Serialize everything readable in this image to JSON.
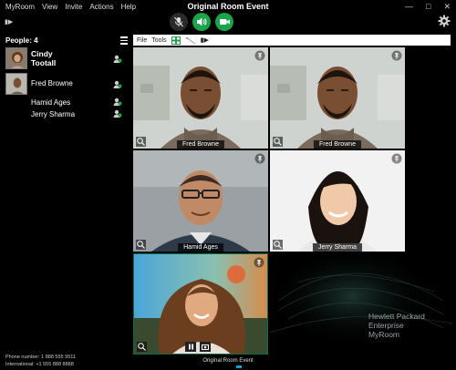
{
  "menu": [
    "MyRoom",
    "View",
    "Invite",
    "Actions",
    "Help"
  ],
  "window": {
    "title": "Original Room Event"
  },
  "sidebar": {
    "people_header": "People: 4",
    "people": [
      {
        "name_line1": "Cindy",
        "name_line2": "Tootall"
      },
      {
        "name": "Fred Browne"
      },
      {
        "name": "Hamid Ages"
      },
      {
        "name": "Jerry Sharma"
      }
    ],
    "footer_phone": "Phone number: 1 888 555 9511",
    "footer_intl": "International: +1 555 888 8888"
  },
  "toolbar": {
    "file": "File",
    "tools": "Tools"
  },
  "tiles": [
    {
      "label": "Fred Browne"
    },
    {
      "label": "Fred Browne"
    },
    {
      "label": "Hamid Ages"
    },
    {
      "label": "Jerry Sharma"
    }
  ],
  "brand": {
    "line1": "Hewlett Packard",
    "line2": "Enterprise",
    "line3": "MyRoom"
  },
  "bottom_label": "Original Room Event",
  "colors": {
    "accent_green": "#1aa34a",
    "tile_border": "#0b6b4a"
  }
}
